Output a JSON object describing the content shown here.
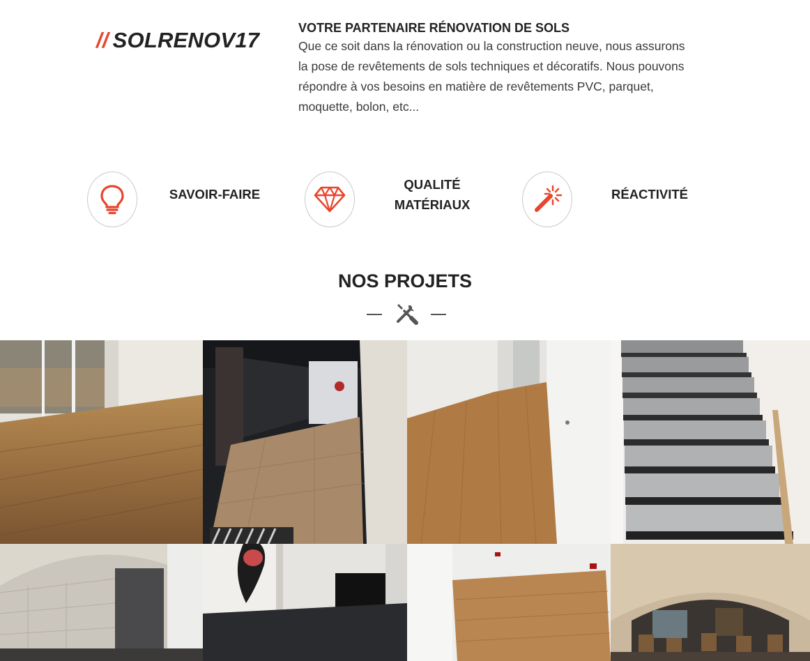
{
  "brand": {
    "slashes": "//",
    "name": "SOLRENOV17"
  },
  "intro": {
    "title": "VOTRE PARTENAIRE RÉNOVATION DE SOLS",
    "line1": "Que ce soit dans la rénovation ou la construction neuve, nous assurons",
    "line2": "la pose de revêtements de sols techniques et décoratifs. Nous pouvons",
    "line3": "répondre à vos besoins en matière de revêtements PVC, parquet,",
    "line4": "moquette, bolon, etc..."
  },
  "features": {
    "one": {
      "label": "SAVOIR-FAIRE",
      "icon": "lightbulb-icon"
    },
    "two": {
      "line1": "QUALITÉ",
      "line2": "MATÉRIAUX",
      "icon": "diamond-icon"
    },
    "three": {
      "label": "RÉACTIVITÉ",
      "icon": "magic-wand-icon"
    }
  },
  "projects": {
    "title": "NOS PROJETS",
    "divider_icon": "tools-icon",
    "photos": [
      "wood-floor-room-with-glass-doors",
      "hotel-corridor-with-tiled-floor",
      "room-with-wood-vinyl-floor-and-doors",
      "staircase-with-grey-treads",
      "stone-vaulted-cellar",
      "room-with-dark-carpet-and-mural",
      "room-with-new-parquet",
      "vaulted-restaurant-hall"
    ]
  },
  "colors": {
    "accent": "#e8452c",
    "text": "#222222",
    "body": "#3a3a3a",
    "circle_border": "#c9c9c9"
  }
}
